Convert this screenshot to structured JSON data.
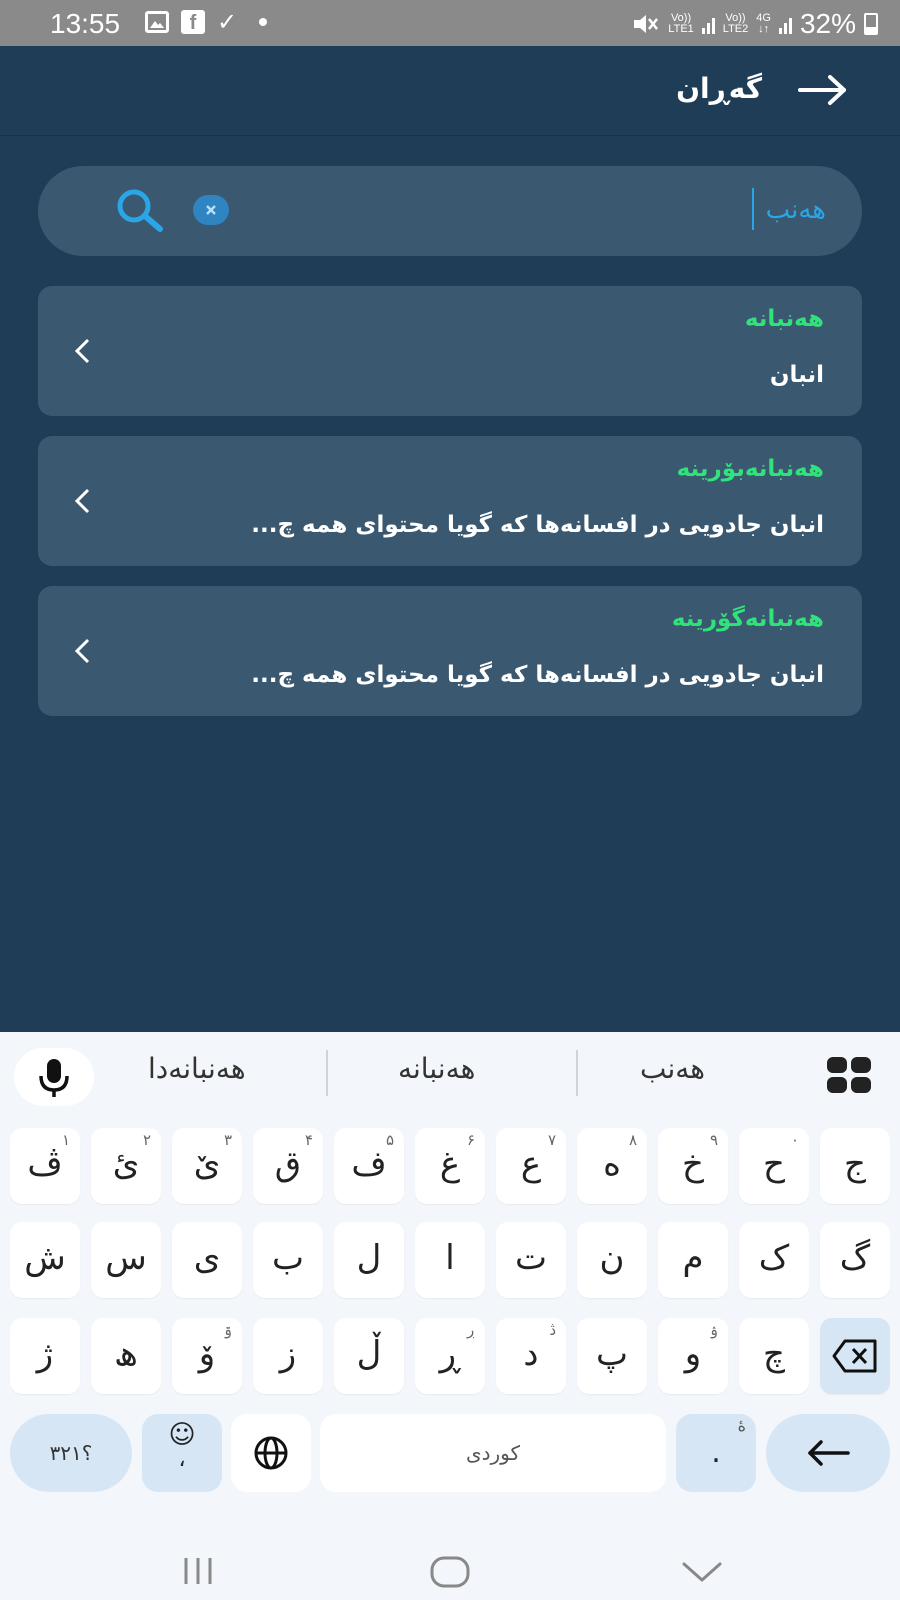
{
  "status_bar": {
    "time": "13:55",
    "battery_percent": "32%",
    "net1_top": "Vo))",
    "net1_bottom": "LTE1",
    "net2_top": "Vo))",
    "net2_bottom": "LTE2",
    "net3_top": "4G",
    "net3_bottom": "↓↑",
    "icons": [
      "gallery-icon",
      "facebook-icon",
      "check-icon",
      "dot-icon",
      "mute-icon",
      "signal-icon",
      "battery-icon"
    ],
    "facebook_letter": "f",
    "check_glyph": "✓"
  },
  "app_bar": {
    "title": "گەڕان"
  },
  "search": {
    "value": "هەنب"
  },
  "results": [
    {
      "title": "هەنبانە",
      "subtitle": "انبان"
    },
    {
      "title": "هەنبانەبۆرینە",
      "subtitle": "انبان جادویی در افسانه‌ها که گویا محتوای همه چ..."
    },
    {
      "title": "هەنبانەگۆرینە",
      "subtitle": "انبان جادویی در افسانه‌ها که گویا محتوای همه چ..."
    }
  ],
  "keyboard": {
    "suggestions": [
      "هەنبانەدا",
      "هەنبانە",
      "هەنب"
    ],
    "row1": [
      {
        "k": "ڤ",
        "h": "١"
      },
      {
        "k": "ئ",
        "h": "٢"
      },
      {
        "k": "ێ",
        "h": "٣"
      },
      {
        "k": "ق",
        "h": "۴"
      },
      {
        "k": "ف",
        "h": "۵"
      },
      {
        "k": "غ",
        "h": "۶"
      },
      {
        "k": "ع",
        "h": "٧"
      },
      {
        "k": "ە",
        "h": "٨"
      },
      {
        "k": "خ",
        "h": "٩"
      },
      {
        "k": "ح",
        "h": "٠"
      },
      {
        "k": "ج",
        "h": ""
      }
    ],
    "row2": [
      "ش",
      "س",
      "ی",
      "ب",
      "ل",
      "ا",
      "ت",
      "ن",
      "م",
      "ک",
      "گ"
    ],
    "row3": [
      {
        "k": "ژ",
        "h": ""
      },
      {
        "k": "ھ",
        "h": ""
      },
      {
        "k": "ۆ",
        "h": "ۊ"
      },
      {
        "k": "ز",
        "h": ""
      },
      {
        "k": "ڵ",
        "h": ""
      },
      {
        "k": "ڕ",
        "h": "ڔ"
      },
      {
        "k": "د",
        "h": "ڎ"
      },
      {
        "k": "پ",
        "h": ""
      },
      {
        "k": "و",
        "h": "ۉ"
      },
      {
        "k": "چ",
        "h": ""
      }
    ],
    "numbers_key": "؟٣٢١",
    "emoji_glyph": "☺",
    "comma_glyph": "،",
    "space_label": "کوردی",
    "period_glyph": ".",
    "period_hint": "ۀ",
    "enter_glyph": "←"
  },
  "colors": {
    "background": "#203d57",
    "card": "#3a5870",
    "accent_green": "#2fe37a",
    "accent_blue": "#2aa6e6"
  }
}
